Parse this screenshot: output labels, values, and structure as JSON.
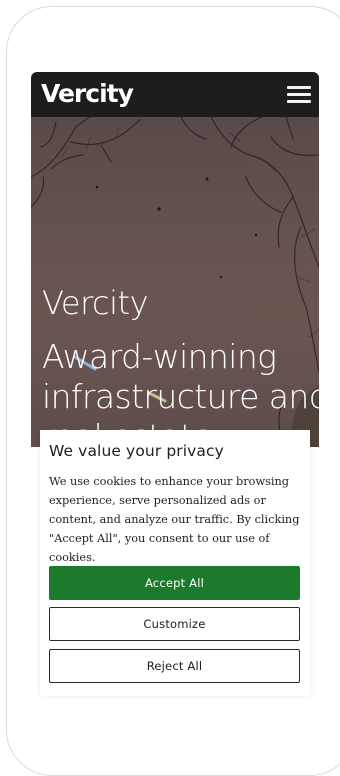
{
  "header": {
    "logo_text": "Vercity",
    "menu_icon": "hamburger-menu-icon"
  },
  "hero": {
    "title": "Vercity",
    "subtitle": "Award-winning infrastructure and real estate"
  },
  "cookie_banner": {
    "title": "We value your privacy",
    "body": "We use cookies to enhance your browsing experience, serve personalized ads or content, and analyze our traffic. By clicking \"Accept All\", you consent to our use of cookies.",
    "accept_label": "Accept All",
    "customize_label": "Customize",
    "reject_label": "Reject All"
  },
  "colors": {
    "header_bg": "#1e1d1c",
    "accept_green": "#1b7a2b",
    "text_dark": "#212121"
  }
}
